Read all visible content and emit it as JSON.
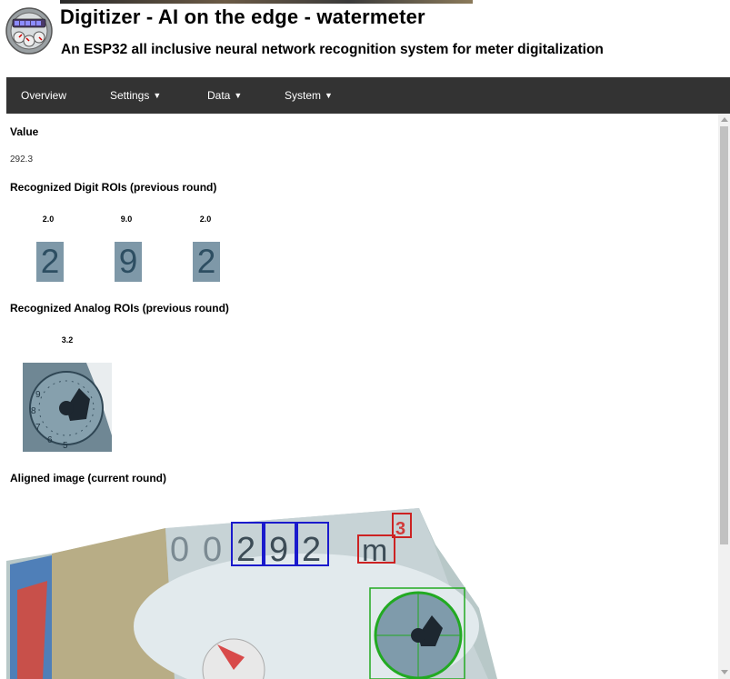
{
  "header": {
    "title": "Digitizer - AI on the edge - watermeter",
    "subtitle": "An ESP32 all inclusive neural network recognition system for meter digitalization"
  },
  "nav": {
    "items": [
      {
        "label": "Overview",
        "has_dropdown": false
      },
      {
        "label": "Settings",
        "has_dropdown": true
      },
      {
        "label": "Data",
        "has_dropdown": true
      },
      {
        "label": "System",
        "has_dropdown": true
      }
    ],
    "dropdown_icon": "chevron-down-icon"
  },
  "main": {
    "value_heading": "Value",
    "value": "292.3",
    "digit_heading": "Recognized Digit ROIs (previous round)",
    "digit_rois": [
      {
        "label": "2.0",
        "digit": "2"
      },
      {
        "label": "9.0",
        "digit": "9"
      },
      {
        "label": "2.0",
        "digit": "2"
      }
    ],
    "analog_heading": "Recognized Analog ROIs (previous round)",
    "analog_rois": [
      {
        "label": "3.2"
      }
    ],
    "aligned_heading": "Aligned image (current round)",
    "aligned_image": {
      "leading_digits": [
        "0",
        "0"
      ],
      "roi_digits": [
        "2",
        "9",
        "2"
      ],
      "unit": "m",
      "unit_exponent": "3"
    }
  },
  "colors": {
    "navbar": "#333333",
    "digit_roi_box": "#1a1acc",
    "unit_roi_box": "#cc2222",
    "analog_roi_box": "#22aa22"
  }
}
